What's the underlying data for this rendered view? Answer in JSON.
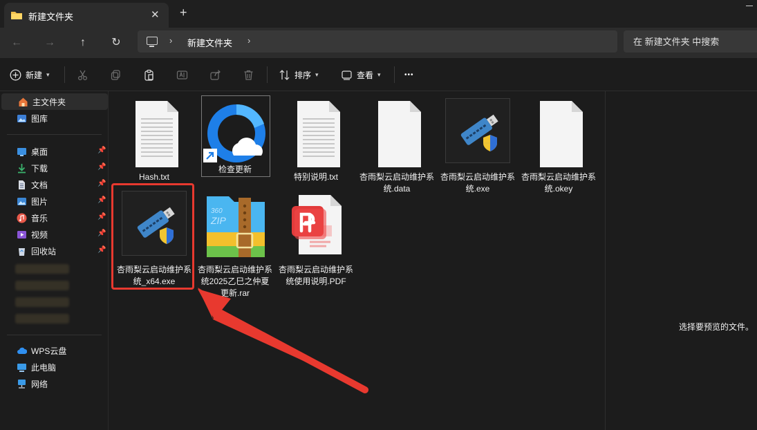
{
  "tab": {
    "title": "新建文件夹",
    "close": "✕",
    "new_tab": "+"
  },
  "address": {
    "crumb": "新建文件夹",
    "sep1": "›",
    "sep2": "›",
    "search_placeholder": "在 新建文件夹 中搜索"
  },
  "nav": {
    "back": "←",
    "forward": "→",
    "up": "↑",
    "refresh": "↻"
  },
  "commands": {
    "new": "新建",
    "sort": "排序",
    "view": "查看",
    "more": "•••"
  },
  "sidebar": {
    "home": "主文件夹",
    "gallery": "图库",
    "quick": [
      {
        "label": "桌面"
      },
      {
        "label": "下载"
      },
      {
        "label": "文档"
      },
      {
        "label": "图片"
      },
      {
        "label": "音乐"
      },
      {
        "label": "视频"
      },
      {
        "label": "回收站"
      }
    ],
    "wps": "WPS云盘",
    "thispc": "此电脑",
    "network": "网络",
    "pin": "📌"
  },
  "files": [
    {
      "name": "Hash.txt",
      "type": "txt"
    },
    {
      "name": "检查更新",
      "type": "shortcut"
    },
    {
      "name": "特别说明.txt",
      "type": "txt"
    },
    {
      "name": "杏雨梨云启动维护系统.data",
      "type": "blank"
    },
    {
      "name": "杏雨梨云启动维护系统.exe",
      "type": "usb"
    },
    {
      "name": "杏雨梨云启动维护系统.okey",
      "type": "blank"
    },
    {
      "name": "杏雨梨云启动维护系统_x64.exe",
      "type": "usb"
    },
    {
      "name": "杏雨梨云启动维护系统2025乙巳之仲夏更新.rar",
      "type": "zip"
    },
    {
      "name": "杏雨梨云启动维护系统使用说明.PDF",
      "type": "pdf"
    }
  ],
  "zip_badge": {
    "line1": "360",
    "line2": "ZIP"
  },
  "preview": {
    "message": "选择要预览的文件。"
  },
  "colors": {
    "accent_red": "#e8392f",
    "folder_yellow": "#f2c14e",
    "selection": "#2d2d2d"
  }
}
